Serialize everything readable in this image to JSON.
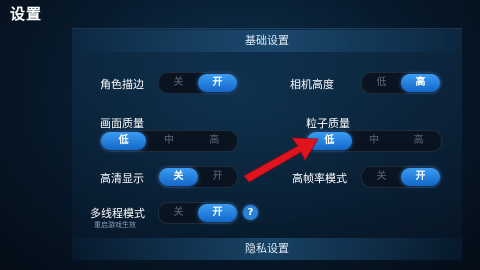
{
  "header": {
    "title": "设置"
  },
  "sections": {
    "basic": "基础设置",
    "privacy": "隐私设置"
  },
  "settings": {
    "role_outline": {
      "label": "角色描边",
      "options": [
        "关",
        "开"
      ],
      "selected": "开"
    },
    "camera_height": {
      "label": "相机高度",
      "options": [
        "低",
        "高"
      ],
      "selected": "高"
    },
    "graphics_quality": {
      "label": "画面质量",
      "options": [
        "低",
        "中",
        "高"
      ],
      "selected": "低"
    },
    "particle_quality": {
      "label": "粒子质量",
      "options": [
        "低",
        "中",
        "高"
      ],
      "selected": "低"
    },
    "hd_display": {
      "label": "高清显示",
      "options": [
        "关",
        "开"
      ],
      "selected": "关"
    },
    "high_fps": {
      "label": "高帧率模式",
      "options": [
        "关",
        "开"
      ],
      "selected": "开"
    },
    "multithread": {
      "label": "多线程模式",
      "sublabel": "重启游戏生效",
      "options": [
        "关",
        "开"
      ],
      "selected": "开"
    }
  },
  "help_button": {
    "glyph": "?"
  },
  "colors": {
    "accent": "#1e7ee0",
    "annotation_arrow": "#e0141e"
  },
  "icons": {
    "help": "question-mark-icon",
    "annotation": "red-arrow-annotation"
  }
}
